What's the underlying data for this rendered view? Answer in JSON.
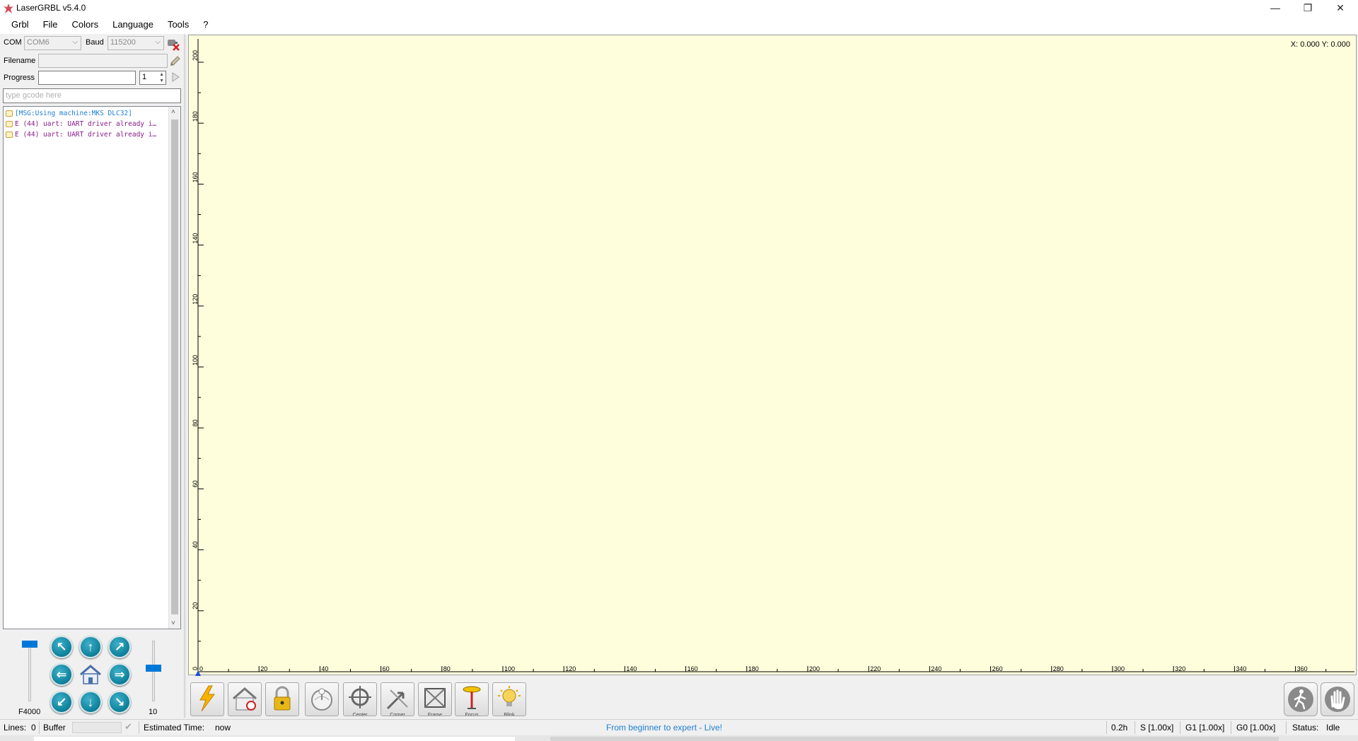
{
  "window": {
    "title": "LaserGRBL v5.4.0",
    "minimize": "—",
    "maximize": "❐",
    "close": "✕"
  },
  "menu": [
    "Grbl",
    "File",
    "Colors",
    "Language",
    "Tools",
    "?"
  ],
  "connection": {
    "com_label": "COM",
    "com_value": "COM6",
    "baud_label": "Baud",
    "baud_value": "115200"
  },
  "file": {
    "filename_label": "Filename",
    "filename_value": ""
  },
  "progress": {
    "label": "Progress",
    "copies": "1"
  },
  "gcode_input": {
    "placeholder": "type gcode here"
  },
  "log": [
    {
      "text": "[MSG:Using machine:MKS DLC32]",
      "color": "#1f7fd6"
    },
    {
      "text": "E (44) uart: UART driver already i…",
      "color": "#8b1a8b"
    },
    {
      "text": "E (44) uart: UART driver already i…",
      "color": "#8b1a8b"
    }
  ],
  "jog": {
    "feed_label": "F4000",
    "step_label": "10",
    "feed_level": 1.0,
    "step_level": 0.55
  },
  "canvas": {
    "coords": "X: 0.000 Y: 0.000",
    "x_ticks": [
      "0",
      "20",
      "40",
      "60",
      "80",
      "100",
      "120",
      "140",
      "160",
      "180",
      "200",
      "220",
      "240",
      "260",
      "280",
      "300",
      "320",
      "340",
      "360"
    ],
    "y_ticks": [
      "0",
      "20",
      "40",
      "60",
      "80",
      "100",
      "120",
      "140",
      "160",
      "180",
      "200"
    ]
  },
  "toolbar": [
    "",
    "",
    "",
    "",
    "Center",
    "Corner",
    "Frame",
    "Focus",
    "Blink"
  ],
  "status": {
    "lines_label": "Lines:",
    "lines_value": "0",
    "buffer_label": "Buffer",
    "est_label": "Estimated Time:",
    "est_value": "now",
    "promo": "From beginner to expert - Live!",
    "time": "0.2h",
    "s_override": "S [1.00x]",
    "g1_override": "G1 [1.00x]",
    "g0_override": "G0 [1.00x]",
    "status_label": "Status:",
    "status_value": "Idle"
  },
  "colors": {
    "canvas_bg": "#fffedc",
    "accent": "#0078d7",
    "promo": "#1f7fd6"
  }
}
